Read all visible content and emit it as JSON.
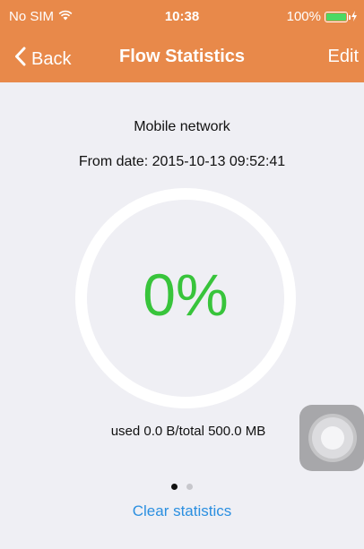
{
  "status_bar": {
    "carrier": "No SIM",
    "time": "10:38",
    "battery": "100%",
    "wifi_icon": "wifi-icon",
    "charging_icon": "charging-icon"
  },
  "nav": {
    "back_label": "Back",
    "title": "Flow Statistics",
    "edit_label": "Edit"
  },
  "stats": {
    "network": "Mobile network",
    "from_date": "From date: 2015-10-13 09:52:41",
    "percent": "0%",
    "usage": "used 0.0 B/total 500.0 MB",
    "progress": 0
  },
  "pager": {
    "page_count": 2,
    "active_index": 0
  },
  "actions": {
    "clear_label": "Clear statistics"
  },
  "colors": {
    "header_bg": "#e8894a",
    "percent": "#38c43b",
    "link": "#2b8fe0",
    "battery": "#4cd964"
  }
}
